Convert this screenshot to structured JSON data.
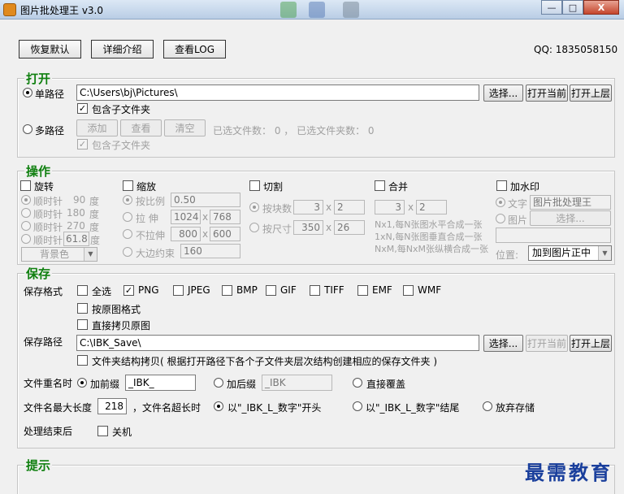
{
  "window": {
    "title": "图片批处理王 v3.0",
    "minimize": "—",
    "maximize": "□",
    "close": "X"
  },
  "toolbar": {
    "reset": "恢复默认",
    "details": "详细介绍",
    "log": "查看LOG",
    "qq": "QQ: 1835058150"
  },
  "open": {
    "title": "打开",
    "single_path": "单路径",
    "path_value": "C:\\Users\\bj\\Pictures\\",
    "select": "选择...",
    "open_current": "打开当前",
    "open_parent": "打开上层",
    "include_sub": "包含子文件夹",
    "multi_path": "多路径",
    "add": "添加",
    "view": "查看",
    "clear": "清空",
    "files_count": "已选文件数：  0  ，  已选文件夹数：  0",
    "include_sub2": "包含子文件夹"
  },
  "ops": {
    "title": "操作",
    "rotate": {
      "label": "旋转",
      "cw90": "顺时针",
      "v90": "90",
      "deg": "度",
      "cw180": "顺时针",
      "v180": "180",
      "cw270": "顺时针",
      "v270": "270",
      "cwc": "顺时针",
      "vc": "61.8",
      "bg": "背景色"
    },
    "scale": {
      "label": "缩放",
      "ratio": "按比例",
      "ratio_v": "0.50",
      "stretch": "拉  伸",
      "sw": "1024",
      "sh": "768",
      "nostretch": "不拉伸",
      "nw": "800",
      "nh": "600",
      "maxside": "大边约束",
      "maxv": "160",
      "x": "x"
    },
    "cut": {
      "label": "切割",
      "by_block": "按块数",
      "bw": "3",
      "bh": "2",
      "by_size": "按尺寸",
      "sw": "350",
      "sh": "26"
    },
    "merge": {
      "label": "合并",
      "mw": "3",
      "mh": "2",
      "n1": "Nx1,每N张图水平合成一张",
      "n2": "1xN,每N张图垂直合成一张",
      "n3": "NxM,每NxM张纵横合成一张"
    },
    "watermark": {
      "label": "加水印",
      "text": "文字",
      "text_v": "图片批处理王",
      "image": "图片",
      "select": "选择...",
      "pos": "位置:",
      "pos_v": "加到图片正中"
    }
  },
  "save": {
    "title": "保存",
    "format": "保存格式",
    "all": "全选",
    "png": "PNG",
    "jpeg": "JPEG",
    "bmp": "BMP",
    "gif": "GIF",
    "tiff": "TIFF",
    "emf": "EMF",
    "wmf": "WMF",
    "orig_format": "按原图格式",
    "copy_orig": "直接拷贝原图",
    "path_label": "保存路径",
    "path_value": "C:\\IBK_Save\\",
    "select": "选择...",
    "open_current": "打开当前",
    "open_parent": "打开上层",
    "struct_copy": "文件夹结构拷贝( 根据打开路径下各个子文件夹层次结构创建相应的保存文件夹 )",
    "rename": "文件重名时",
    "prefix": "加前缀",
    "prefix_v": "_IBK_",
    "suffix": "加后缀",
    "suffix_v": "_IBK",
    "overwrite": "直接覆盖",
    "maxlen_label": "文件名最大长度",
    "maxlen": "218",
    "overlen": "，文件名超长时",
    "start": "以\"_IBK_L_数字\"开头",
    "end": "以\"_IBK_L_数字\"结尾",
    "abandon": "放弃存储",
    "after": "处理结束后",
    "shutdown": "关机"
  },
  "hint": {
    "title": "提示"
  },
  "brand": "最需教育"
}
